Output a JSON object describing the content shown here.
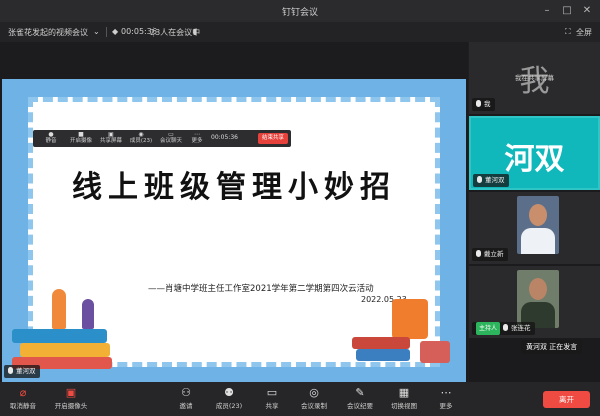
{
  "window": {
    "title": "钉钉会议",
    "fullscreen_label": "全屏"
  },
  "infobar": {
    "meeting_name": "张雀花发起的视频会议",
    "elapsed": "00:05:36",
    "participants": "23人在会议中"
  },
  "slide": {
    "heading": "线上班级管理小妙招",
    "subtitle": "——肖塘中学班主任工作室2021学年第二学期第四次云活动",
    "date": "2022.05.23"
  },
  "sharebar": {
    "buttons": [
      "静音",
      "开启摄像",
      "共享屏幕",
      "成员(23)",
      "会议聊天",
      "更多"
    ],
    "time": "00:05:36",
    "end_label": "结束共享"
  },
  "stage_speaker": "董河双",
  "tiles": [
    {
      "initial": "我",
      "label": "我",
      "share_text": "我在共享屏幕"
    },
    {
      "initial": "河双",
      "label": "董河双"
    },
    {
      "label": "戴立新"
    },
    {
      "label": "张连花",
      "host_label": "主持人"
    }
  ],
  "speaking_popup": "黄河双 正在发言",
  "toolbar": {
    "items": [
      "取消静音",
      "开启摄像头",
      "邀请",
      "成员(23)",
      "共享",
      "会议录制",
      "会议纪要",
      "切换视图",
      "更多"
    ],
    "leave_label": "离开"
  },
  "colors": {
    "accent_active": "#11b8bb",
    "leave": "#f04b42",
    "host": "#2db55d"
  }
}
